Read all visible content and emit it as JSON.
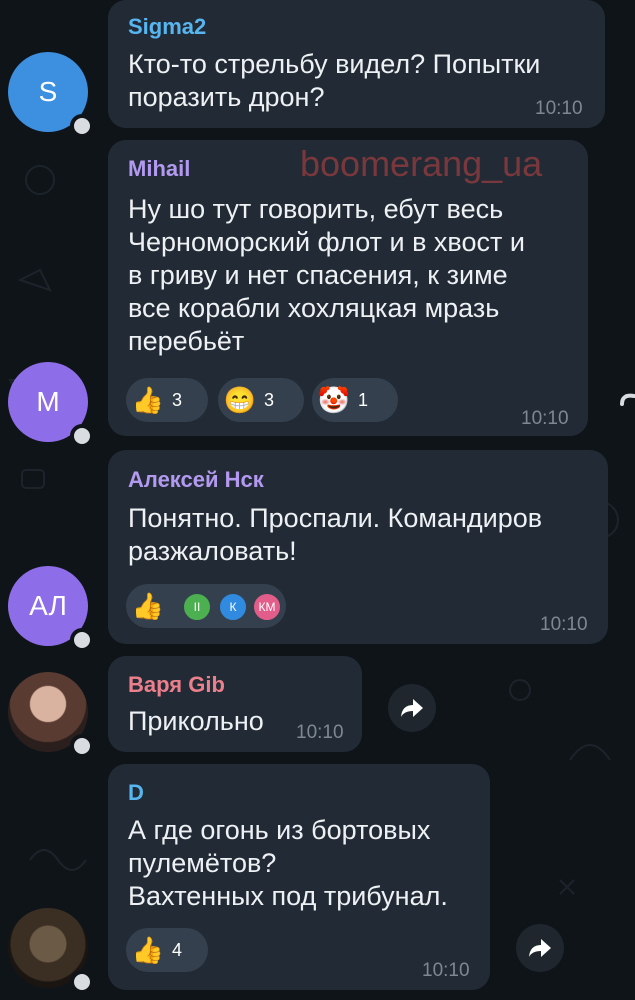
{
  "watermark": "boomerang_ua",
  "messages": [
    {
      "author": "Sigma2",
      "author_color": "#57b5f0",
      "avatar_initials": "S",
      "avatar_color": "#3d8fe0",
      "text": "Кто-то стрельбу видел? Попытки\nпоразить дрон?",
      "time": "10:10"
    },
    {
      "author": "Mihail",
      "author_color": "#b39af0",
      "avatar_initials": "M",
      "avatar_color": "#8e6ee8",
      "text": "Ну шо тут говорить, ебут весь\nЧерноморский флот и в хвост и\nв гриву и нет спасения, к зиме\nвсе корабли хохляцкая мразь\nперебьёт",
      "time": "10:10",
      "reactions": [
        {
          "emoji": "👍",
          "count": "3"
        },
        {
          "emoji": "😁",
          "count": "3"
        },
        {
          "emoji": "🤡",
          "count": "1"
        }
      ]
    },
    {
      "author": "Алексей Нск",
      "author_color": "#b39af0",
      "avatar_initials": "АЛ",
      "avatar_color": "#8e6ee8",
      "text": "Понятно. Проспали. Командиров\nразжаловать!",
      "time": "10:10",
      "reactions": [
        {
          "emoji": "👍",
          "reactors": [
            "II",
            "К",
            "КМ"
          ]
        }
      ]
    },
    {
      "author": "Варя Gib",
      "author_color": "#ec7f8c",
      "text": "Прикольно",
      "time": "10:10"
    },
    {
      "author": "D",
      "author_color": "#57b5f0",
      "text": "А где огонь из бортовых\nпулемётов?\nВахтенных под трибунал.",
      "time": "10:10",
      "reactions": [
        {
          "emoji": "👍",
          "count": "4"
        }
      ]
    }
  ]
}
